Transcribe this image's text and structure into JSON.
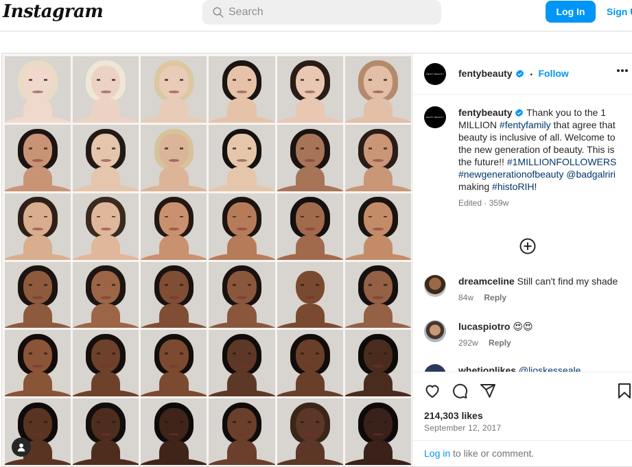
{
  "app": {
    "logo_text": "Instagram"
  },
  "header": {
    "search_placeholder": "Search",
    "login_label": "Log In",
    "signup_label": "Sign Up"
  },
  "post": {
    "username": "fentybeauty",
    "avatar_text": "FENTY BEAUTY",
    "follow_label": "Follow",
    "separator": "•",
    "caption": {
      "username": "fentybeauty",
      "text_1": "Thank you to the 1 MILLION ",
      "tag_1": "#fentyfamily",
      "text_2": " that agree that beauty is inclusive of all. Welcome to the new generation of beauty. This is the future!! ",
      "tag_2": "#1MILLIONFOLLOWERS",
      "tag_3": "#newgenerationofbeauty",
      "tag_4": "@badgalriri",
      "text_3": " making ",
      "tag_5": "#histoRIH",
      "text_4": "!",
      "meta": "Edited · 359w"
    },
    "comments": [
      {
        "username": "dreamceline",
        "text": "Still can't find my shade",
        "age": "84w",
        "reply": "Reply"
      },
      {
        "username": "lucaspiotro",
        "text": "😍😍",
        "age": "292w",
        "reply": "Reply"
      }
    ],
    "partial_comment": {
      "username": "whetionlikes",
      "text": "@lioskesseale"
    },
    "likes": "214,303 likes",
    "date": "September 12, 2017",
    "login_prompt": {
      "link": "Log in",
      "rest": " to like or comment."
    }
  },
  "colors": {
    "accent": "#0095f6",
    "tag": "#00376b",
    "muted": "#737373",
    "border": "#dbdbdb"
  },
  "icons": [
    "search-icon",
    "verified-badge-icon",
    "more-options-icon",
    "add-comment-icon",
    "heart-icon",
    "comment-icon",
    "share-icon",
    "bookmark-icon",
    "user-tag-icon"
  ]
}
